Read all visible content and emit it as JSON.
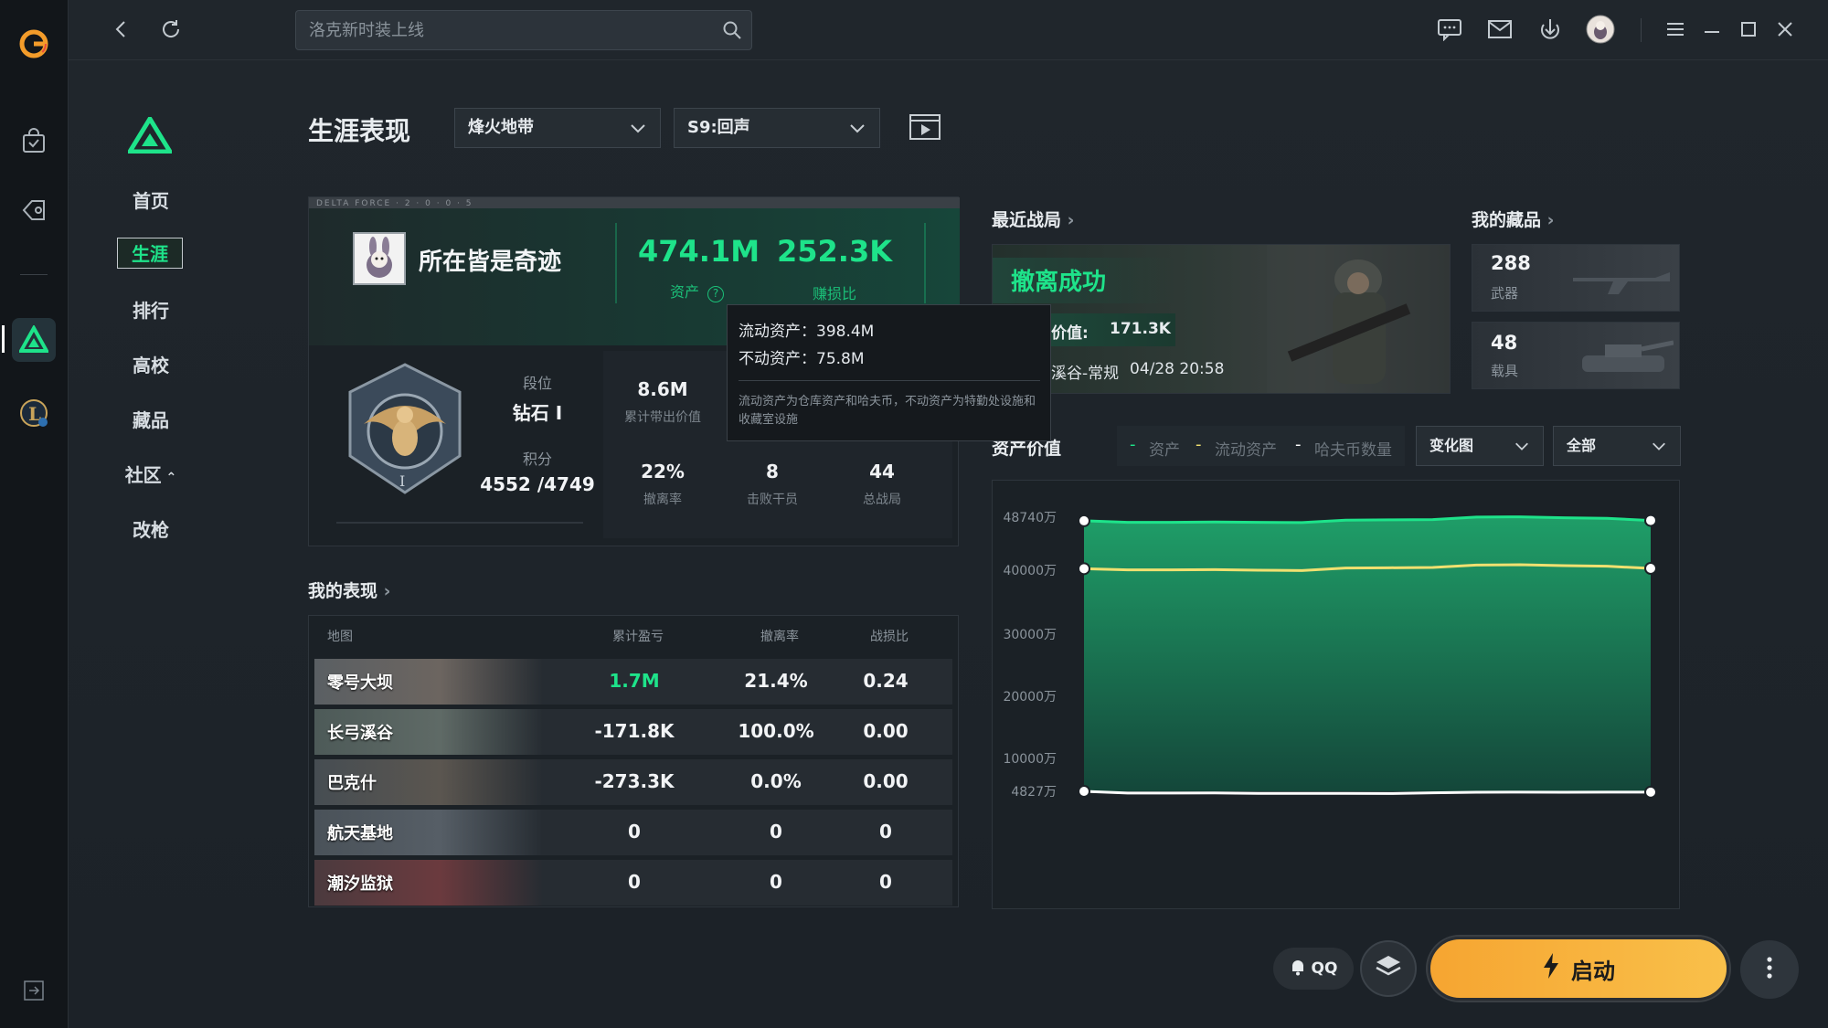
{
  "topbar": {
    "search_placeholder": "洛克新时装上线"
  },
  "nav": {
    "items": [
      "首页",
      "生涯",
      "排行",
      "高校",
      "藏品",
      "社区",
      "改枪"
    ],
    "active": "生涯"
  },
  "header": {
    "title": "生涯表现",
    "mode_dropdown": "烽火地带",
    "season_dropdown": "S9:回声"
  },
  "profile": {
    "stripe_text": "DELTA FORCE · 2 · 0 · 0 · 5",
    "player_name": "所在皆是奇迹",
    "assets_value": "474.1M",
    "assets_label": "资产",
    "kd_value": "252.3K",
    "kd_label": "赚损比",
    "rank_label": "段位",
    "rank_value": "钻石 I",
    "points_label": "积分",
    "points_value": "4552 /4749",
    "stats": [
      {
        "value": "8.6M",
        "label": "累计带出价值"
      },
      {
        "value": "22%",
        "label": "撤离率"
      },
      {
        "value": "8",
        "label": "击败干员"
      },
      {
        "value": "44",
        "label": "总战局"
      }
    ]
  },
  "tooltip": {
    "liquid": "流动资产：398.4M",
    "fixed": "不动资产：75.8M",
    "note": "流动资产为仓库资产和哈夫币，不动资产为特勤处设施和收藏室设施"
  },
  "performance": {
    "title": "我的表现",
    "columns": [
      "地图",
      "累计盈亏",
      "撤离率",
      "战损比"
    ],
    "rows": [
      {
        "map": "零号大坝",
        "profit": "1.7M",
        "rate": "21.4%",
        "ratio": "0.24",
        "highlight": true
      },
      {
        "map": "长弓溪谷",
        "profit": "-171.8K",
        "rate": "100.0%",
        "ratio": "0.00",
        "highlight": false
      },
      {
        "map": "巴克什",
        "profit": "-273.3K",
        "rate": "0.0%",
        "ratio": "0.00",
        "highlight": false
      },
      {
        "map": "航天基地",
        "profit": "0",
        "rate": "0",
        "ratio": "0",
        "highlight": false
      },
      {
        "map": "潮汐监狱",
        "profit": "0",
        "rate": "0",
        "ratio": "0",
        "highlight": false
      }
    ]
  },
  "recent": {
    "title": "最近战局",
    "result": "撤离成功",
    "value_label": "带出价值:",
    "value": "171.3K",
    "mode": "长弓溪谷-常规",
    "time": "04/28 20:58"
  },
  "collection": {
    "title": "我的藏品",
    "items": [
      {
        "count": "288",
        "label": "武器"
      },
      {
        "count": "48",
        "label": "载具"
      }
    ]
  },
  "asset_chart": {
    "title": "资产价值",
    "legend": [
      "资产",
      "流动资产",
      "哈夫币数量"
    ],
    "view_dropdown": "变化图",
    "range_dropdown": "全部"
  },
  "chart_data": {
    "type": "line",
    "ytick_labels": [
      "48740万",
      "40000万",
      "30000万",
      "20000万",
      "10000万",
      "4827万"
    ],
    "ytick_values": [
      48740,
      40000,
      30000,
      20000,
      10000,
      4827
    ],
    "series": [
      {
        "name": "资产",
        "color": "#1ee38a",
        "values": [
          48150,
          47900,
          47900,
          47950,
          47900,
          47850,
          48250,
          48300,
          48350,
          48750,
          48800,
          48650,
          48550,
          48200
        ]
      },
      {
        "name": "流动资产",
        "color": "#f0e070",
        "values": [
          40250,
          40050,
          40050,
          40100,
          40000,
          39950,
          40350,
          40400,
          40450,
          40850,
          40900,
          40750,
          40650,
          40300
        ]
      },
      {
        "name": "哈夫币数量",
        "color": "#ffffff",
        "values": [
          4827,
          4550,
          4550,
          4580,
          4500,
          4500,
          4500,
          4480,
          4600,
          4680,
          4700,
          4680,
          4700,
          4700
        ]
      }
    ],
    "ylim": [
      4827,
      48740
    ]
  },
  "bottom": {
    "qq_label": "QQ",
    "launch_label": "启动"
  },
  "colors": {
    "accent": "#1ee38a",
    "launch": "#f6a531"
  }
}
